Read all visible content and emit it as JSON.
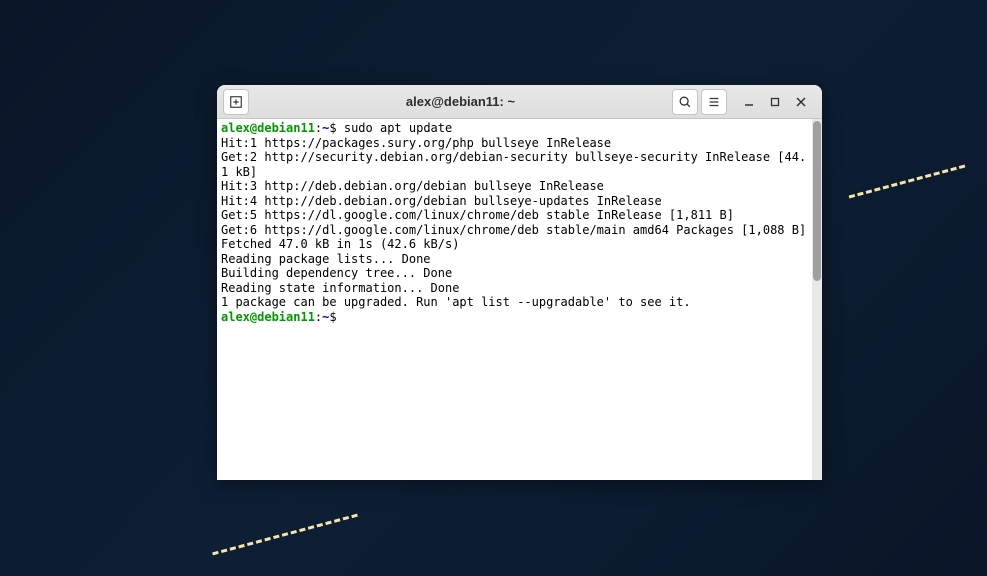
{
  "window": {
    "title": "alex@debian11: ~"
  },
  "terminal": {
    "prompt_user_host": "alex@debian11",
    "prompt_separator": ":",
    "prompt_path": "~",
    "prompt_symbol": "$ ",
    "command": "sudo apt update",
    "lines": [
      "Hit:1 https://packages.sury.org/php bullseye InRelease",
      "Get:2 http://security.debian.org/debian-security bullseye-security InRelease [44.1 kB]",
      "Hit:3 http://deb.debian.org/debian bullseye InRelease",
      "Hit:4 http://deb.debian.org/debian bullseye-updates InRelease",
      "Get:5 https://dl.google.com/linux/chrome/deb stable InRelease [1,811 B]",
      "Get:6 https://dl.google.com/linux/chrome/deb stable/main amd64 Packages [1,088 B]",
      "Fetched 47.0 kB in 1s (42.6 kB/s)",
      "Reading package lists... Done",
      "Building dependency tree... Done",
      "Reading state information... Done",
      "1 package can be upgraded. Run 'apt list --upgradable' to see it."
    ]
  }
}
